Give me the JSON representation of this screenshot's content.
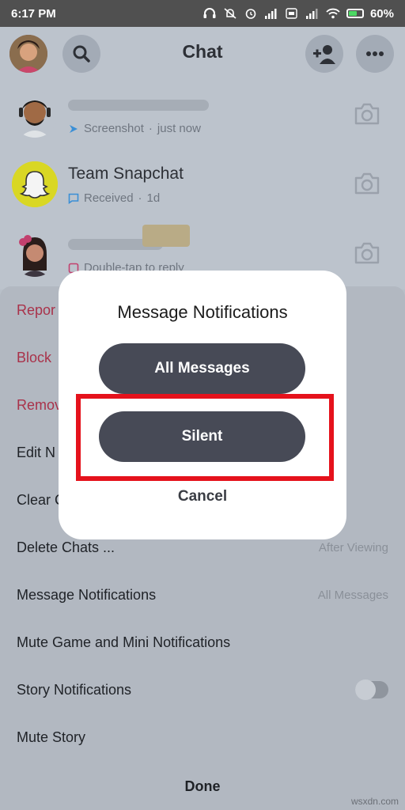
{
  "status_bar": {
    "time": "6:17 PM",
    "battery": "60%",
    "battery_level": 0.6
  },
  "header": {
    "title": "Chat"
  },
  "chats": [
    {
      "name": "",
      "status": "Screenshot",
      "time": "just now"
    },
    {
      "name": "Team Snapchat",
      "status": "Received",
      "time": "1d"
    },
    {
      "name": "",
      "status": "Double-tap to reply",
      "time": ""
    }
  ],
  "chat_separator": "·",
  "sheet": {
    "items": [
      {
        "label": "Repor",
        "value": ""
      },
      {
        "label": "Block",
        "value": ""
      },
      {
        "label": "Remov",
        "value": ""
      },
      {
        "label": "Edit N",
        "value": ""
      },
      {
        "label": "Clear C",
        "value": ""
      },
      {
        "label": "Delete Chats ...",
        "value": "After Viewing"
      },
      {
        "label": "Message Notifications",
        "value": "All Messages"
      },
      {
        "label": "Mute Game and Mini Notifications",
        "value": ""
      },
      {
        "label": "Story Notifications",
        "toggle": false
      },
      {
        "label": "Mute Story",
        "value": ""
      }
    ],
    "done_label": "Done"
  },
  "dialog": {
    "title": "Message Notifications",
    "option_all": "All Messages",
    "option_silent": "Silent",
    "cancel": "Cancel"
  },
  "watermark": "wsxdn.com",
  "colors": {
    "dialog_button": "#474a56",
    "highlight": "#e5121c",
    "destructive": "#a9324a",
    "snapchat_yellow": "#fffc00"
  }
}
